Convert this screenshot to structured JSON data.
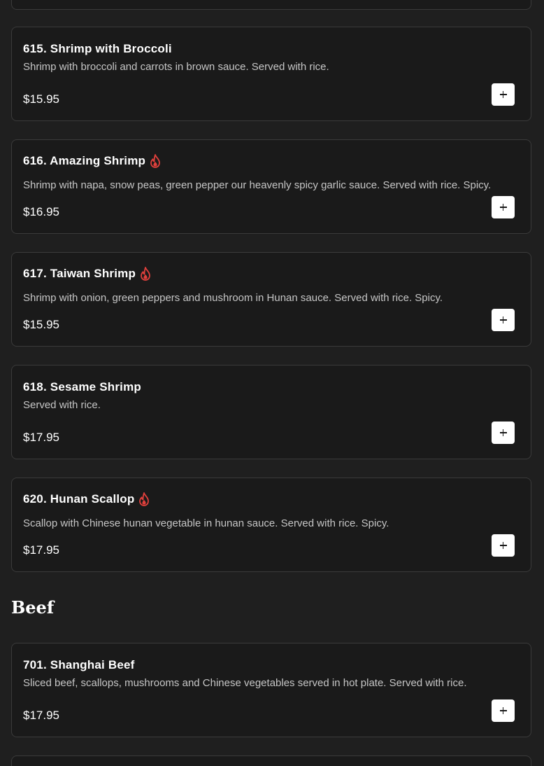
{
  "items": [
    {
      "title": "615. Shrimp with Broccoli",
      "description": "Shrimp with broccoli and carrots in brown sauce. Served with rice.",
      "price": "$15.95",
      "spicy": false,
      "add_icon": "plus-icon"
    },
    {
      "title": "616. Amazing Shrimp",
      "description": "Shrimp with napa, snow peas, green pepper our heavenly spicy garlic sauce. Served with rice. Spicy.",
      "price": "$16.95",
      "spicy": true,
      "add_icon": "plus-icon"
    },
    {
      "title": "617. Taiwan Shrimp",
      "description": "Shrimp with onion, green peppers and mushroom in Hunan sauce. Served with rice. Spicy.",
      "price": "$15.95",
      "spicy": true,
      "add_icon": "plus-icon"
    },
    {
      "title": "618. Sesame Shrimp",
      "description": "Served with rice.",
      "price": "$17.95",
      "spicy": false,
      "add_icon": "plus-icon"
    },
    {
      "title": "620. Hunan Scallop",
      "description": "Scallop with Chinese hunan vegetable in hunan sauce. Served with rice. Spicy.",
      "price": "$17.95",
      "spicy": true,
      "add_icon": "plus-icon"
    }
  ],
  "section": {
    "title": "Beef"
  },
  "beef_items": [
    {
      "title": "701. Shanghai Beef",
      "description": "Sliced beef, scallops, mushrooms and Chinese vegetables served in hot plate. Served with rice.",
      "price": "$17.95",
      "spicy": false,
      "add_icon": "plus-icon"
    }
  ],
  "colors": {
    "background": "#1f1f1f",
    "card": "#1a1a1a",
    "border": "#3b3b3b",
    "spicy_icon": "#e0403c"
  }
}
